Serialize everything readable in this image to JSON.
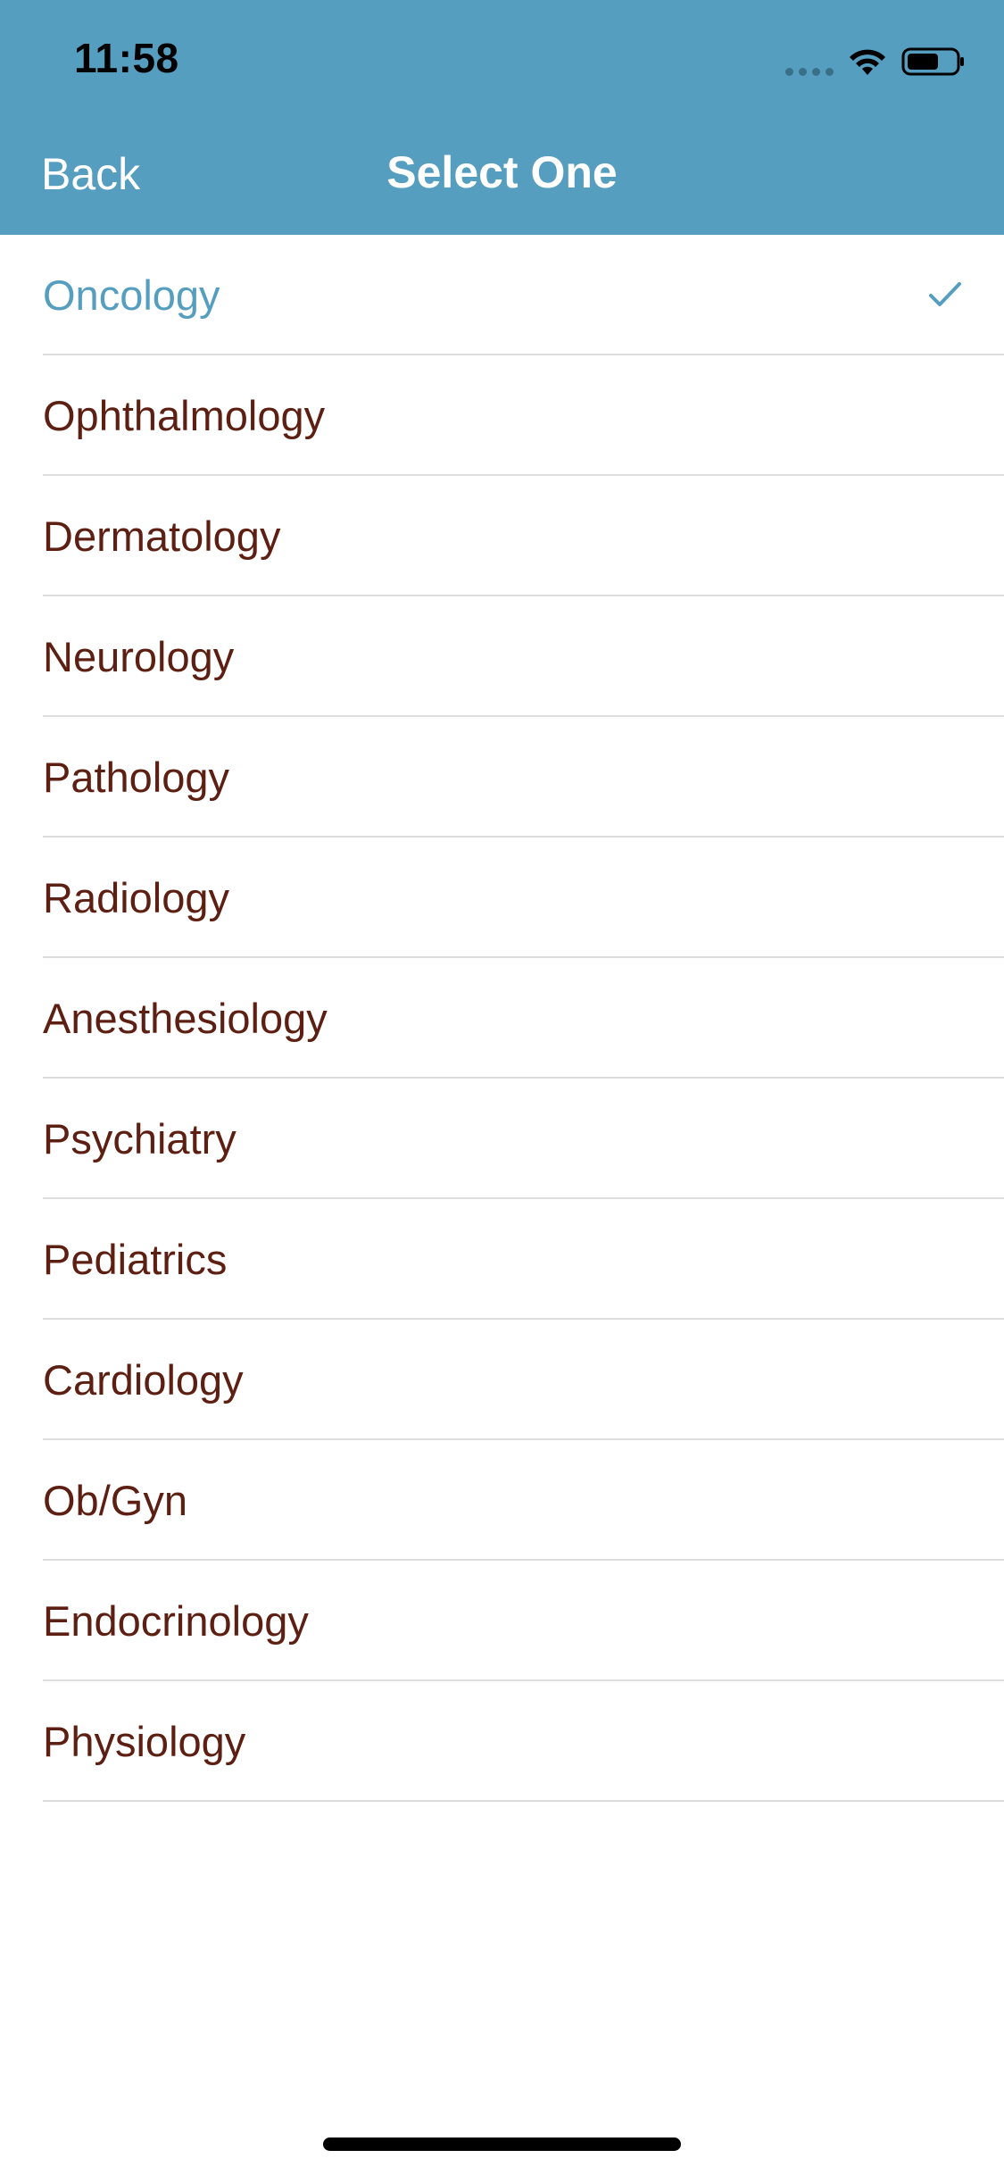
{
  "status_bar": {
    "time": "11:58",
    "icons": [
      "signal-dots-icon",
      "wifi-icon",
      "battery-icon"
    ]
  },
  "nav_bar": {
    "back_label": "Back",
    "title": "Select One"
  },
  "colors": {
    "accent": "#559ec0",
    "item_text": "#5e1f13",
    "divider": "#dddddd"
  },
  "list": {
    "selected_index": 0,
    "items": [
      {
        "label": "Oncology"
      },
      {
        "label": "Ophthalmology"
      },
      {
        "label": "Dermatology"
      },
      {
        "label": "Neurology"
      },
      {
        "label": "Pathology"
      },
      {
        "label": "Radiology"
      },
      {
        "label": "Anesthesiology"
      },
      {
        "label": "Psychiatry"
      },
      {
        "label": "Pediatrics"
      },
      {
        "label": "Cardiology"
      },
      {
        "label": "Ob/Gyn"
      },
      {
        "label": "Endocrinology"
      },
      {
        "label": "Physiology"
      }
    ]
  }
}
